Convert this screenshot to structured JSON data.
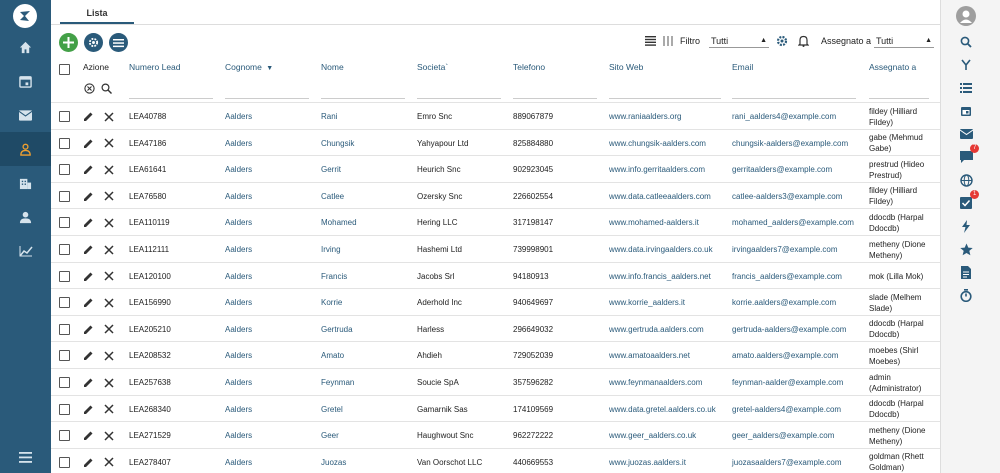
{
  "tab": "Lista",
  "toolbar": {
    "filtro_label": "Filtro",
    "filtro_value": "Tutti",
    "assegnato_label": "Assegnato a",
    "assegnato_value": "Tutti"
  },
  "columns": {
    "azione": "Azione",
    "numero": "Numero Lead",
    "cognome": "Cognome",
    "nome": "Nome",
    "societa": "Societa`",
    "telefono": "Telefono",
    "sito": "Sito Web",
    "email": "Email",
    "assegnato": "Assegnato a"
  },
  "badges": {
    "messages": "7",
    "tasks": "1"
  },
  "colors": {
    "sidebar": "#2a5a7a",
    "accent_green": "#43a047",
    "link": "#2a5a7a",
    "badge": "#e53935"
  },
  "rows": [
    {
      "num": "LEA40788",
      "cognome": "Aalders",
      "nome": "Rani",
      "soc": "Emro Snc",
      "tel": "889067879",
      "sito": "www.raniaalders.org",
      "email": "rani_aalders4@example.com",
      "ass1": "fildey (Hilliard",
      "ass2": "Fildey)"
    },
    {
      "num": "LEA47186",
      "cognome": "Aalders",
      "nome": "Chungsik",
      "soc": "Yahyapour Ltd",
      "tel": "825884880",
      "sito": "www.chungsik-aalders.com",
      "email": "chungsik-aalders@example.com",
      "ass1": "gabe (Mehmud",
      "ass2": "Gabe)"
    },
    {
      "num": "LEA61641",
      "cognome": "Aalders",
      "nome": "Gerrit",
      "soc": "Heurich Snc",
      "tel": "902923045",
      "sito": "www.info.gerritaalders.com",
      "email": "gerritaalders@example.com",
      "ass1": "prestrud (Hideo",
      "ass2": "Prestrud)"
    },
    {
      "num": "LEA76580",
      "cognome": "Aalders",
      "nome": "Catlee",
      "soc": "Ozersky Snc",
      "tel": "226602554",
      "sito": "www.data.catleeaalders.com",
      "email": "catlee-aalders3@example.com",
      "ass1": "fildey (Hilliard",
      "ass2": "Fildey)"
    },
    {
      "num": "LEA110119",
      "cognome": "Aalders",
      "nome": "Mohamed",
      "soc": "Hering LLC",
      "tel": "317198147",
      "sito": "www.mohamed-aalders.it",
      "email": "mohamed_aalders@example.com",
      "ass1": "ddocdb (Harpal",
      "ass2": "Ddocdb)"
    },
    {
      "num": "LEA112111",
      "cognome": "Aalders",
      "nome": "Irving",
      "soc": "Hashemi Ltd",
      "tel": "739998901",
      "sito": "www.data.irvingaalders.co.uk",
      "email": "irvingaalders7@example.com",
      "ass1": "metheny (Dione",
      "ass2": "Metheny)"
    },
    {
      "num": "LEA120100",
      "cognome": "Aalders",
      "nome": "Francis",
      "soc": "Jacobs Srl",
      "tel": "94180913",
      "sito": "www.info.francis_aalders.net",
      "email": "francis_aalders@example.com",
      "ass1": "mok (Lilla Mok)",
      "ass2": ""
    },
    {
      "num": "LEA156990",
      "cognome": "Aalders",
      "nome": "Korrie",
      "soc": "Aderhold Inc",
      "tel": "940649697",
      "sito": "www.korrie_aalders.it",
      "email": "korrie.aalders@example.com",
      "ass1": "slade (Melhem",
      "ass2": "Slade)"
    },
    {
      "num": "LEA205210",
      "cognome": "Aalders",
      "nome": "Gertruda",
      "soc": "Harless",
      "tel": "296649032",
      "sito": "www.gertruda.aalders.com",
      "email": "gertruda-aalders@example.com",
      "ass1": "ddocdb (Harpal",
      "ass2": "Ddocdb)"
    },
    {
      "num": "LEA208532",
      "cognome": "Aalders",
      "nome": "Amato",
      "soc": "Ahdieh",
      "tel": "729052039",
      "sito": "www.amatoaalders.net",
      "email": "amato.aalders@example.com",
      "ass1": "moebes (Shirl",
      "ass2": "Moebes)"
    },
    {
      "num": "LEA257638",
      "cognome": "Aalders",
      "nome": "Feynman",
      "soc": "Soucie SpA",
      "tel": "357596282",
      "sito": "www.feynmanaalders.com",
      "email": "feynman-aalder@example.com",
      "ass1": "admin",
      "ass2": "(Administrator)"
    },
    {
      "num": "LEA268340",
      "cognome": "Aalders",
      "nome": "Gretel",
      "soc": "Gamarnik Sas",
      "tel": "174109569",
      "sito": "www.data.gretel.aalders.co.uk",
      "email": "gretel-aalders4@example.com",
      "ass1": "ddocdb (Harpal",
      "ass2": "Ddocdb)"
    },
    {
      "num": "LEA271529",
      "cognome": "Aalders",
      "nome": "Geer",
      "soc": "Haughwout Snc",
      "tel": "962272222",
      "sito": "www.geer_aalders.co.uk",
      "email": "geer_aalders@example.com",
      "ass1": "metheny (Dione",
      "ass2": "Metheny)"
    },
    {
      "num": "LEA278407",
      "cognome": "Aalders",
      "nome": "Juozas",
      "soc": "Van Oorschot LLC",
      "tel": "440669553",
      "sito": "www.juozas.aalders.it",
      "email": "juozasaalders7@example.com",
      "ass1": "goldman (Rhett",
      "ass2": "Goldman)"
    }
  ]
}
